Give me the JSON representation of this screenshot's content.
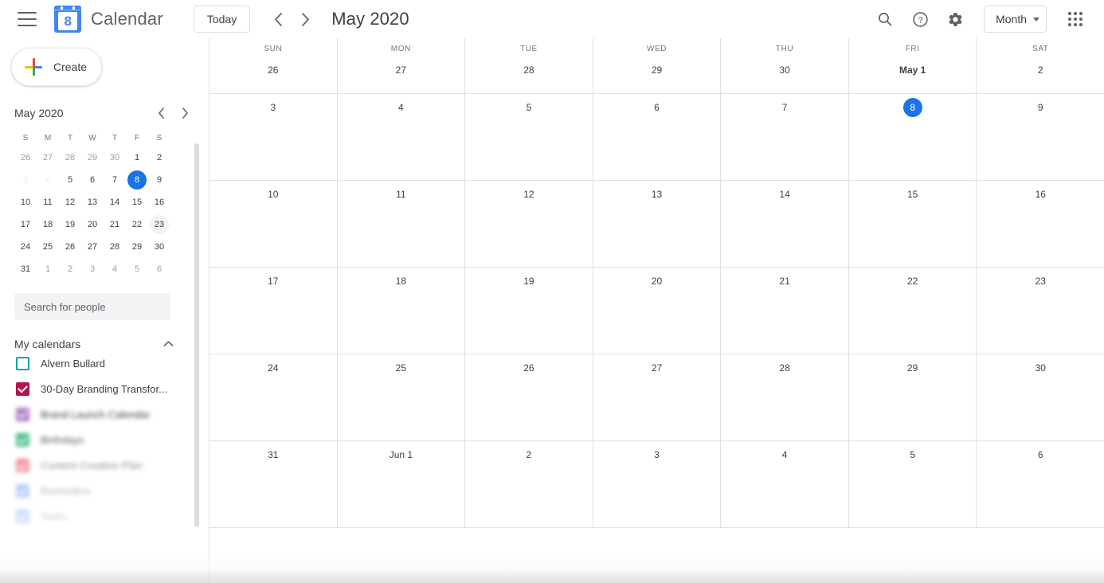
{
  "topbar": {
    "menu_icon": "hamburger-menu-icon",
    "logo_day": "8",
    "brand": "Calendar",
    "today_label": "Today",
    "prev_icon": "chevron-left-icon",
    "next_icon": "chevron-right-icon",
    "period_title": "May 2020",
    "search_icon": "search-icon",
    "help_icon": "help-circle-icon",
    "settings_icon": "gear-icon",
    "view_label": "Month",
    "apps_icon": "apps-grid-icon"
  },
  "sidebar": {
    "create_label": "Create",
    "create_icon": "plus-icon",
    "mini": {
      "title": "May 2020",
      "prev_icon": "chevron-left-icon",
      "next_icon": "chevron-right-icon",
      "weekdays": [
        "S",
        "M",
        "T",
        "W",
        "T",
        "F",
        "S"
      ],
      "weeks": [
        [
          {
            "d": "26",
            "state": "other"
          },
          {
            "d": "27",
            "state": "other"
          },
          {
            "d": "28",
            "state": "other"
          },
          {
            "d": "29",
            "state": "other"
          },
          {
            "d": "30",
            "state": "other"
          },
          {
            "d": "1",
            "state": "normal"
          },
          {
            "d": "2",
            "state": "normal"
          }
        ],
        [
          {
            "d": "3",
            "state": "ghost"
          },
          {
            "d": "4",
            "state": "ghost"
          },
          {
            "d": "5",
            "state": "normal"
          },
          {
            "d": "6",
            "state": "normal"
          },
          {
            "d": "7",
            "state": "normal"
          },
          {
            "d": "8",
            "state": "today"
          },
          {
            "d": "9",
            "state": "normal"
          }
        ],
        [
          {
            "d": "10",
            "state": "normal"
          },
          {
            "d": "11",
            "state": "normal"
          },
          {
            "d": "12",
            "state": "normal"
          },
          {
            "d": "13",
            "state": "normal"
          },
          {
            "d": "14",
            "state": "normal"
          },
          {
            "d": "15",
            "state": "normal"
          },
          {
            "d": "16",
            "state": "normal"
          }
        ],
        [
          {
            "d": "17",
            "state": "normal"
          },
          {
            "d": "18",
            "state": "normal"
          },
          {
            "d": "19",
            "state": "normal"
          },
          {
            "d": "20",
            "state": "normal"
          },
          {
            "d": "21",
            "state": "normal"
          },
          {
            "d": "22",
            "state": "normal"
          },
          {
            "d": "23",
            "state": "hover"
          }
        ],
        [
          {
            "d": "24",
            "state": "normal"
          },
          {
            "d": "25",
            "state": "normal"
          },
          {
            "d": "26",
            "state": "normal"
          },
          {
            "d": "27",
            "state": "normal"
          },
          {
            "d": "28",
            "state": "normal"
          },
          {
            "d": "29",
            "state": "normal"
          },
          {
            "d": "30",
            "state": "normal"
          }
        ],
        [
          {
            "d": "31",
            "state": "normal"
          },
          {
            "d": "1",
            "state": "other"
          },
          {
            "d": "2",
            "state": "other"
          },
          {
            "d": "3",
            "state": "other"
          },
          {
            "d": "4",
            "state": "other"
          },
          {
            "d": "5",
            "state": "other"
          },
          {
            "d": "6",
            "state": "other"
          }
        ]
      ]
    },
    "people_search_placeholder": "Search for people",
    "my_calendars": {
      "label": "My calendars",
      "chevron_icon": "chevron-up-icon",
      "items": [
        {
          "name": "Alvern Bullard",
          "checked": false,
          "color": "#00a3b5",
          "faded": false
        },
        {
          "name": "30-Day Branding Transfor...",
          "checked": true,
          "color": "#b5124e",
          "faded": false
        },
        {
          "name": "Brand Launch Calendar",
          "checked": true,
          "color": "#b07cc6",
          "faded": true
        },
        {
          "name": "Birthdays",
          "checked": true,
          "color": "#33b679",
          "faded": true
        },
        {
          "name": "Content Creation Plan",
          "checked": true,
          "color": "#e8515b",
          "faded": true
        },
        {
          "name": "Reminders",
          "checked": true,
          "color": "#4285f4",
          "faded": true
        },
        {
          "name": "Tasks",
          "checked": true,
          "color": "#4285f4",
          "faded": true
        }
      ]
    }
  },
  "grid": {
    "day_headers": [
      {
        "dow": "SUN",
        "num": "26",
        "bold": false,
        "today": false
      },
      {
        "dow": "MON",
        "num": "27",
        "bold": false,
        "today": false
      },
      {
        "dow": "TUE",
        "num": "28",
        "bold": false,
        "today": false
      },
      {
        "dow": "WED",
        "num": "29",
        "bold": false,
        "today": false
      },
      {
        "dow": "THU",
        "num": "30",
        "bold": false,
        "today": false
      },
      {
        "dow": "FRI",
        "num": "May 1",
        "bold": true,
        "today": false
      },
      {
        "dow": "SAT",
        "num": "2",
        "bold": false,
        "today": false
      }
    ],
    "weeks": [
      [
        {
          "n": "3",
          "today": false
        },
        {
          "n": "4",
          "today": false
        },
        {
          "n": "5",
          "today": false
        },
        {
          "n": "6",
          "today": false
        },
        {
          "n": "7",
          "today": false
        },
        {
          "n": "8",
          "today": true
        },
        {
          "n": "9",
          "today": false
        }
      ],
      [
        {
          "n": "10",
          "today": false
        },
        {
          "n": "11",
          "today": false
        },
        {
          "n": "12",
          "today": false
        },
        {
          "n": "13",
          "today": false
        },
        {
          "n": "14",
          "today": false
        },
        {
          "n": "15",
          "today": false
        },
        {
          "n": "16",
          "today": false
        }
      ],
      [
        {
          "n": "17",
          "today": false
        },
        {
          "n": "18",
          "today": false
        },
        {
          "n": "19",
          "today": false
        },
        {
          "n": "20",
          "today": false
        },
        {
          "n": "21",
          "today": false
        },
        {
          "n": "22",
          "today": false
        },
        {
          "n": "23",
          "today": false
        }
      ],
      [
        {
          "n": "24",
          "today": false
        },
        {
          "n": "25",
          "today": false
        },
        {
          "n": "26",
          "today": false
        },
        {
          "n": "27",
          "today": false
        },
        {
          "n": "28",
          "today": false
        },
        {
          "n": "29",
          "today": false
        },
        {
          "n": "30",
          "today": false
        }
      ],
      [
        {
          "n": "31",
          "today": false
        },
        {
          "n": "Jun 1",
          "today": false
        },
        {
          "n": "2",
          "today": false
        },
        {
          "n": "3",
          "today": false
        },
        {
          "n": "4",
          "today": false
        },
        {
          "n": "5",
          "today": false
        },
        {
          "n": "6",
          "today": false
        }
      ]
    ]
  },
  "colors": {
    "accent": "#1a73e8",
    "border": "#e0e0e0",
    "text": "#3c4043",
    "muted": "#70757a"
  }
}
